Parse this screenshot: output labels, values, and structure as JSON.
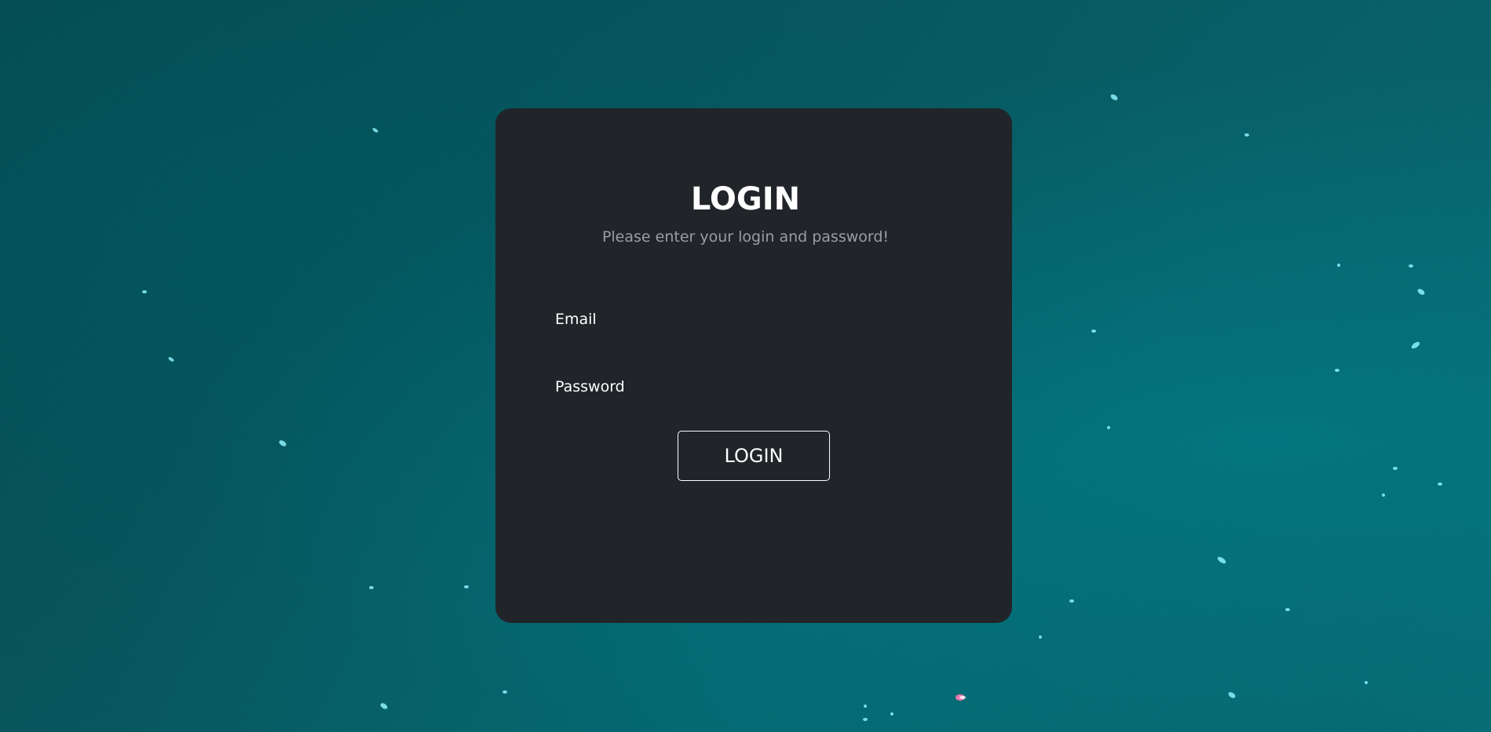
{
  "login": {
    "title": "LOGIN",
    "subtitle": "Please enter your login and password!",
    "email_label": "Email",
    "email_value": "",
    "password_label": "Password",
    "password_value": "",
    "button_label": "LOGIN"
  },
  "colors": {
    "card_background": "#212429",
    "background_teal": "#0a5962",
    "subtitle_gray": "#9a9da1",
    "text_white": "#ffffff"
  }
}
